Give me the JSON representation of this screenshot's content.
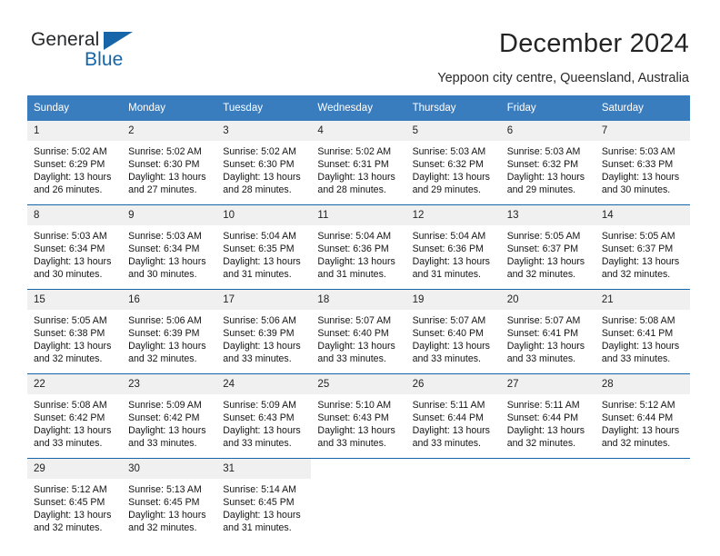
{
  "brand": {
    "line1": "General",
    "line2": "Blue",
    "logo_icon": "triangle-logo-icon"
  },
  "header": {
    "title": "December 2024",
    "location": "Yeppoon city centre, Queensland, Australia"
  },
  "weekday_headers": [
    "Sunday",
    "Monday",
    "Tuesday",
    "Wednesday",
    "Thursday",
    "Friday",
    "Saturday"
  ],
  "colors": {
    "header_blue": "#3a7dbf",
    "border_blue": "#1565a8",
    "daynum_band": "#f0f0f0",
    "brand_blue": "#1565a8"
  },
  "weeks": [
    [
      {
        "day": "1",
        "sunrise": "Sunrise: 5:02 AM",
        "sunset": "Sunset: 6:29 PM",
        "daylight1": "Daylight: 13 hours",
        "daylight2": "and 26 minutes."
      },
      {
        "day": "2",
        "sunrise": "Sunrise: 5:02 AM",
        "sunset": "Sunset: 6:30 PM",
        "daylight1": "Daylight: 13 hours",
        "daylight2": "and 27 minutes."
      },
      {
        "day": "3",
        "sunrise": "Sunrise: 5:02 AM",
        "sunset": "Sunset: 6:30 PM",
        "daylight1": "Daylight: 13 hours",
        "daylight2": "and 28 minutes."
      },
      {
        "day": "4",
        "sunrise": "Sunrise: 5:02 AM",
        "sunset": "Sunset: 6:31 PM",
        "daylight1": "Daylight: 13 hours",
        "daylight2": "and 28 minutes."
      },
      {
        "day": "5",
        "sunrise": "Sunrise: 5:03 AM",
        "sunset": "Sunset: 6:32 PM",
        "daylight1": "Daylight: 13 hours",
        "daylight2": "and 29 minutes."
      },
      {
        "day": "6",
        "sunrise": "Sunrise: 5:03 AM",
        "sunset": "Sunset: 6:32 PM",
        "daylight1": "Daylight: 13 hours",
        "daylight2": "and 29 minutes."
      },
      {
        "day": "7",
        "sunrise": "Sunrise: 5:03 AM",
        "sunset": "Sunset: 6:33 PM",
        "daylight1": "Daylight: 13 hours",
        "daylight2": "and 30 minutes."
      }
    ],
    [
      {
        "day": "8",
        "sunrise": "Sunrise: 5:03 AM",
        "sunset": "Sunset: 6:34 PM",
        "daylight1": "Daylight: 13 hours",
        "daylight2": "and 30 minutes."
      },
      {
        "day": "9",
        "sunrise": "Sunrise: 5:03 AM",
        "sunset": "Sunset: 6:34 PM",
        "daylight1": "Daylight: 13 hours",
        "daylight2": "and 30 minutes."
      },
      {
        "day": "10",
        "sunrise": "Sunrise: 5:04 AM",
        "sunset": "Sunset: 6:35 PM",
        "daylight1": "Daylight: 13 hours",
        "daylight2": "and 31 minutes."
      },
      {
        "day": "11",
        "sunrise": "Sunrise: 5:04 AM",
        "sunset": "Sunset: 6:36 PM",
        "daylight1": "Daylight: 13 hours",
        "daylight2": "and 31 minutes."
      },
      {
        "day": "12",
        "sunrise": "Sunrise: 5:04 AM",
        "sunset": "Sunset: 6:36 PM",
        "daylight1": "Daylight: 13 hours",
        "daylight2": "and 31 minutes."
      },
      {
        "day": "13",
        "sunrise": "Sunrise: 5:05 AM",
        "sunset": "Sunset: 6:37 PM",
        "daylight1": "Daylight: 13 hours",
        "daylight2": "and 32 minutes."
      },
      {
        "day": "14",
        "sunrise": "Sunrise: 5:05 AM",
        "sunset": "Sunset: 6:37 PM",
        "daylight1": "Daylight: 13 hours",
        "daylight2": "and 32 minutes."
      }
    ],
    [
      {
        "day": "15",
        "sunrise": "Sunrise: 5:05 AM",
        "sunset": "Sunset: 6:38 PM",
        "daylight1": "Daylight: 13 hours",
        "daylight2": "and 32 minutes."
      },
      {
        "day": "16",
        "sunrise": "Sunrise: 5:06 AM",
        "sunset": "Sunset: 6:39 PM",
        "daylight1": "Daylight: 13 hours",
        "daylight2": "and 32 minutes."
      },
      {
        "day": "17",
        "sunrise": "Sunrise: 5:06 AM",
        "sunset": "Sunset: 6:39 PM",
        "daylight1": "Daylight: 13 hours",
        "daylight2": "and 33 minutes."
      },
      {
        "day": "18",
        "sunrise": "Sunrise: 5:07 AM",
        "sunset": "Sunset: 6:40 PM",
        "daylight1": "Daylight: 13 hours",
        "daylight2": "and 33 minutes."
      },
      {
        "day": "19",
        "sunrise": "Sunrise: 5:07 AM",
        "sunset": "Sunset: 6:40 PM",
        "daylight1": "Daylight: 13 hours",
        "daylight2": "and 33 minutes."
      },
      {
        "day": "20",
        "sunrise": "Sunrise: 5:07 AM",
        "sunset": "Sunset: 6:41 PM",
        "daylight1": "Daylight: 13 hours",
        "daylight2": "and 33 minutes."
      },
      {
        "day": "21",
        "sunrise": "Sunrise: 5:08 AM",
        "sunset": "Sunset: 6:41 PM",
        "daylight1": "Daylight: 13 hours",
        "daylight2": "and 33 minutes."
      }
    ],
    [
      {
        "day": "22",
        "sunrise": "Sunrise: 5:08 AM",
        "sunset": "Sunset: 6:42 PM",
        "daylight1": "Daylight: 13 hours",
        "daylight2": "and 33 minutes."
      },
      {
        "day": "23",
        "sunrise": "Sunrise: 5:09 AM",
        "sunset": "Sunset: 6:42 PM",
        "daylight1": "Daylight: 13 hours",
        "daylight2": "and 33 minutes."
      },
      {
        "day": "24",
        "sunrise": "Sunrise: 5:09 AM",
        "sunset": "Sunset: 6:43 PM",
        "daylight1": "Daylight: 13 hours",
        "daylight2": "and 33 minutes."
      },
      {
        "day": "25",
        "sunrise": "Sunrise: 5:10 AM",
        "sunset": "Sunset: 6:43 PM",
        "daylight1": "Daylight: 13 hours",
        "daylight2": "and 33 minutes."
      },
      {
        "day": "26",
        "sunrise": "Sunrise: 5:11 AM",
        "sunset": "Sunset: 6:44 PM",
        "daylight1": "Daylight: 13 hours",
        "daylight2": "and 33 minutes."
      },
      {
        "day": "27",
        "sunrise": "Sunrise: 5:11 AM",
        "sunset": "Sunset: 6:44 PM",
        "daylight1": "Daylight: 13 hours",
        "daylight2": "and 32 minutes."
      },
      {
        "day": "28",
        "sunrise": "Sunrise: 5:12 AM",
        "sunset": "Sunset: 6:44 PM",
        "daylight1": "Daylight: 13 hours",
        "daylight2": "and 32 minutes."
      }
    ],
    [
      {
        "day": "29",
        "sunrise": "Sunrise: 5:12 AM",
        "sunset": "Sunset: 6:45 PM",
        "daylight1": "Daylight: 13 hours",
        "daylight2": "and 32 minutes."
      },
      {
        "day": "30",
        "sunrise": "Sunrise: 5:13 AM",
        "sunset": "Sunset: 6:45 PM",
        "daylight1": "Daylight: 13 hours",
        "daylight2": "and 32 minutes."
      },
      {
        "day": "31",
        "sunrise": "Sunrise: 5:14 AM",
        "sunset": "Sunset: 6:45 PM",
        "daylight1": "Daylight: 13 hours",
        "daylight2": "and 31 minutes."
      },
      {
        "day": "",
        "sunrise": "",
        "sunset": "",
        "daylight1": "",
        "daylight2": ""
      },
      {
        "day": "",
        "sunrise": "",
        "sunset": "",
        "daylight1": "",
        "daylight2": ""
      },
      {
        "day": "",
        "sunrise": "",
        "sunset": "",
        "daylight1": "",
        "daylight2": ""
      },
      {
        "day": "",
        "sunrise": "",
        "sunset": "",
        "daylight1": "",
        "daylight2": ""
      }
    ]
  ]
}
